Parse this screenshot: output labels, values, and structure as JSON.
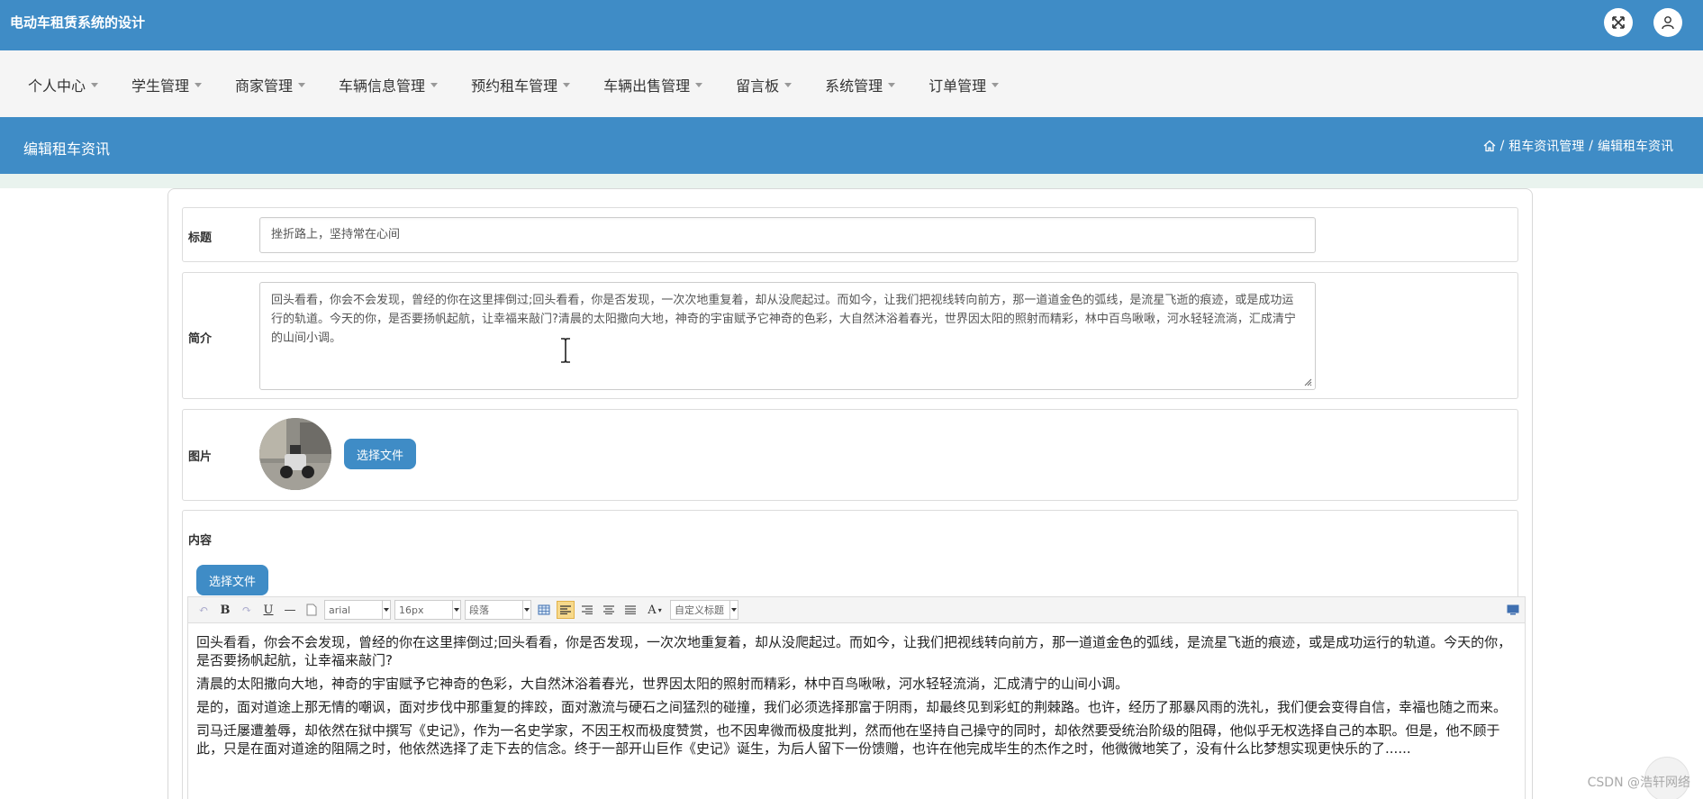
{
  "header": {
    "app_title": "电动车租赁系统的设计",
    "icons": [
      "fullscreen-icon",
      "user-icon"
    ]
  },
  "menu": {
    "items": [
      {
        "label": "个人中心"
      },
      {
        "label": "学生管理"
      },
      {
        "label": "商家管理"
      },
      {
        "label": "车辆信息管理"
      },
      {
        "label": "预约租车管理"
      },
      {
        "label": "车辆出售管理"
      },
      {
        "label": "留言板"
      },
      {
        "label": "系统管理"
      },
      {
        "label": "订单管理"
      }
    ]
  },
  "page": {
    "title": "编辑租车资讯",
    "breadcrumb": {
      "home_icon": "home-icon",
      "items": [
        "租车资讯管理",
        "编辑租车资讯"
      ]
    }
  },
  "form": {
    "title_label": "标题",
    "title_value": "挫折路上，坚持常在心间",
    "summary_label": "简介",
    "summary_value": "回头看看，你会不会发现，曾经的你在这里摔倒过;回头看看，你是否发现，一次次地重复着，却从没爬起过。而如今，让我们把视线转向前方，那一道道金色的弧线，是流星飞逝的痕迹，或是成功运行的轨道。今天的你，是否要扬帆起航，让幸福来敲门?清晨的太阳撒向大地，神奇的宇宙赋予它神奇的色彩，大自然沐浴着春光，世界因太阳的照射而精彩，林中百鸟啾啾，河水轻轻流淌，汇成清宁的山间小调。",
    "image_label": "图片",
    "choose_file_label": "选择文件",
    "content_label": "内容",
    "content_choose_file_label": "选择文件"
  },
  "editor": {
    "font_family": "arial",
    "font_size": "16px",
    "paragraph": "段落",
    "custom_title": "自定义标题",
    "paragraphs": [
      "回头看看，你会不会发现，曾经的你在这里摔倒过;回头看看，你是否发现，一次次地重复着，却从没爬起过。而如今，让我们把视线转向前方，那一道道金色的弧线，是流星飞逝的痕迹，或是成功运行的轨道。今天的你，是否要扬帆起航，让幸福来敲门?",
      "清晨的太阳撒向大地，神奇的宇宙赋予它神奇的色彩，大自然沐浴着春光，世界因太阳的照射而精彩，林中百鸟啾啾，河水轻轻流淌，汇成清宁的山间小调。",
      "是的，面对道途上那无情的嘲讽，面对步伐中那重复的摔跤，面对激流与硬石之间猛烈的碰撞，我们必须选择那富于阴雨，却最终见到彩虹的荆棘路。也许，经历了那暴风雨的洗礼，我们便会变得自信，幸福也随之而来。",
      "司马迁屡遭羞辱，却依然在狱中撰写《史记》，作为一名史学家，不因王权而极度赞赏，也不因卑微而极度批判，然而他在坚持自己操守的同时，却依然要受统治阶级的阻碍，他似乎无权选择自己的本职。但是，他不顾于此，只是在面对道途的阻隔之时，他依然选择了走下去的信念。终于一部开山巨作《史记》诞生，为后人留下一份馈赠，也许在他完成毕生的杰作之时，他微微地笑了，没有什么比梦想实现更快乐的了......"
    ]
  },
  "watermark": "CSDN @浩轩网络",
  "colors": {
    "primary": "#3f8cc6",
    "menu_bg": "#f5f5f5",
    "strip": "#e9f3ee"
  }
}
